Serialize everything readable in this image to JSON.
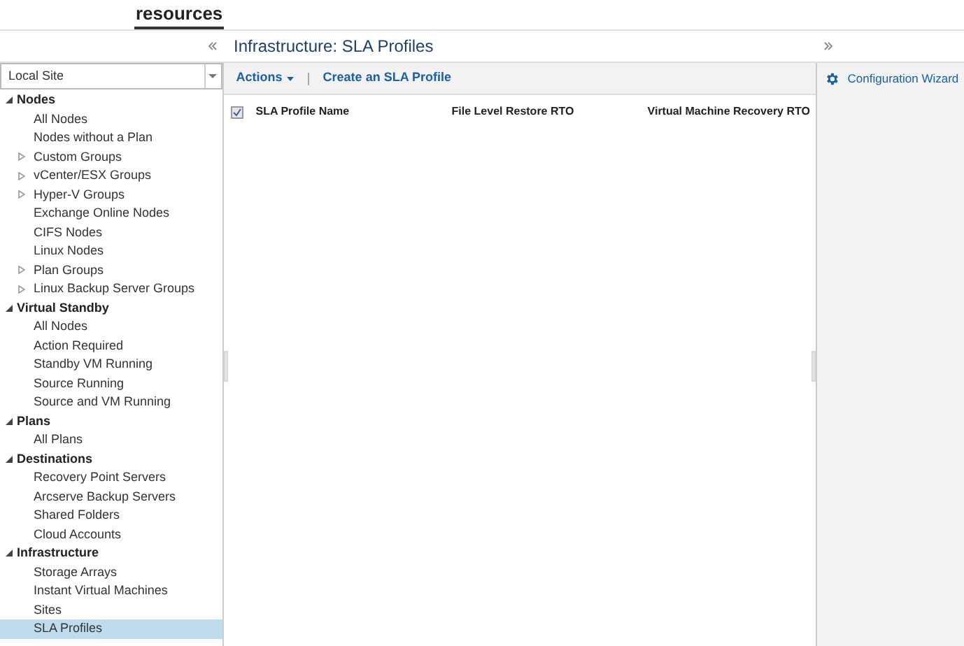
{
  "header": {
    "tabs": [
      {
        "label": "resources",
        "selected": true
      }
    ]
  },
  "site_select": {
    "value": "Local Site"
  },
  "tree": [
    {
      "label": "Nodes",
      "expanded": true,
      "children": [
        {
          "label": "All Nodes",
          "selected": false
        },
        {
          "label": "Nodes without a Plan",
          "selected": false
        },
        {
          "label": "Custom Groups",
          "selected": false,
          "expanded": false
        },
        {
          "label": "vCenter/ESX Groups",
          "selected": false,
          "expanded": false
        },
        {
          "label": "Hyper-V Groups",
          "selected": false,
          "expanded": false
        },
        {
          "label": "Exchange Online Nodes",
          "selected": false
        },
        {
          "label": "CIFS Nodes",
          "selected": false
        },
        {
          "label": "Linux Nodes",
          "selected": false
        },
        {
          "label": "Plan Groups",
          "selected": false,
          "expanded": false
        },
        {
          "label": "Linux Backup Server Groups",
          "selected": false,
          "expanded": false
        }
      ]
    },
    {
      "label": "Virtual Standby",
      "expanded": true,
      "children": [
        {
          "label": "All Nodes",
          "selected": false
        },
        {
          "label": "Action Required",
          "selected": false
        },
        {
          "label": "Standby VM Running",
          "selected": false
        },
        {
          "label": "Source Running",
          "selected": false
        },
        {
          "label": "Source and VM Running",
          "selected": false
        }
      ]
    },
    {
      "label": "Plans",
      "expanded": true,
      "children": [
        {
          "label": "All Plans",
          "selected": false
        }
      ]
    },
    {
      "label": "Destinations",
      "expanded": true,
      "children": [
        {
          "label": "Recovery Point Servers",
          "selected": false
        },
        {
          "label": "Arcserve Backup Servers",
          "selected": false
        },
        {
          "label": "Shared Folders",
          "selected": false
        },
        {
          "label": "Cloud Accounts",
          "selected": false
        }
      ]
    },
    {
      "label": "Infrastructure",
      "expanded": true,
      "children": [
        {
          "label": "Storage Arrays",
          "selected": false
        },
        {
          "label": "Instant Virtual Machines",
          "selected": false
        },
        {
          "label": "Sites",
          "selected": false
        },
        {
          "label": "SLA Profiles",
          "selected": true
        }
      ]
    }
  ],
  "main": {
    "title": "Infrastructure: SLA Profiles",
    "toolbar": {
      "actions": "Actions",
      "create": "Create an SLA Profile"
    },
    "table": {
      "select_all_checked": true,
      "columns": [
        "SLA Profile Name",
        "File Level Restore RTO",
        "Virtual Machine Recovery RTO"
      ]
    }
  },
  "right_panel": {
    "link": "Configuration Wizard"
  }
}
